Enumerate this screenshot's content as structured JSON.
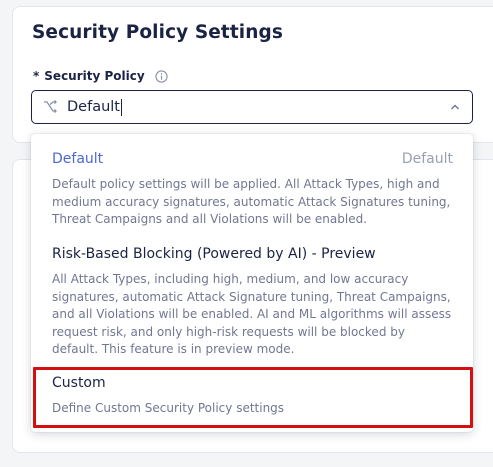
{
  "page": {
    "title": "Security Policy Settings"
  },
  "field": {
    "required_marker": "*",
    "label": "Security Policy",
    "info_icon": "info-icon"
  },
  "select": {
    "icon": "policy-branch-icon",
    "value": "Default",
    "chevron_icon": "chevron-up-icon"
  },
  "dropdown": {
    "options": [
      {
        "title": "Default",
        "meta": "Default",
        "description": "Default policy settings will be applied. All Attack Types, high and medium accuracy signatures, automatic Attack Signatures tuning, Threat Campaigns and all Violations will be enabled.",
        "selected": true
      },
      {
        "title": "Risk-Based Blocking (Powered by AI) - Preview",
        "meta": "",
        "description": "All Attack Types, including high, medium, and low accuracy signatures, automatic Attack Signature tuning, Threat Campaigns, and all Violations will be enabled. AI and ML algorithms will assess request risk, and only high-risk requests will be blocked by default. This feature is in preview mode.",
        "selected": false
      },
      {
        "title": "Custom",
        "meta": "",
        "description": "Define Custom Security Policy settings",
        "selected": false,
        "highlighted": true
      }
    ]
  },
  "colors": {
    "text_primary": "#1b2345",
    "text_secondary": "#717791",
    "selected_option": "#4c67d3",
    "highlight_box": "#d50f0f"
  }
}
